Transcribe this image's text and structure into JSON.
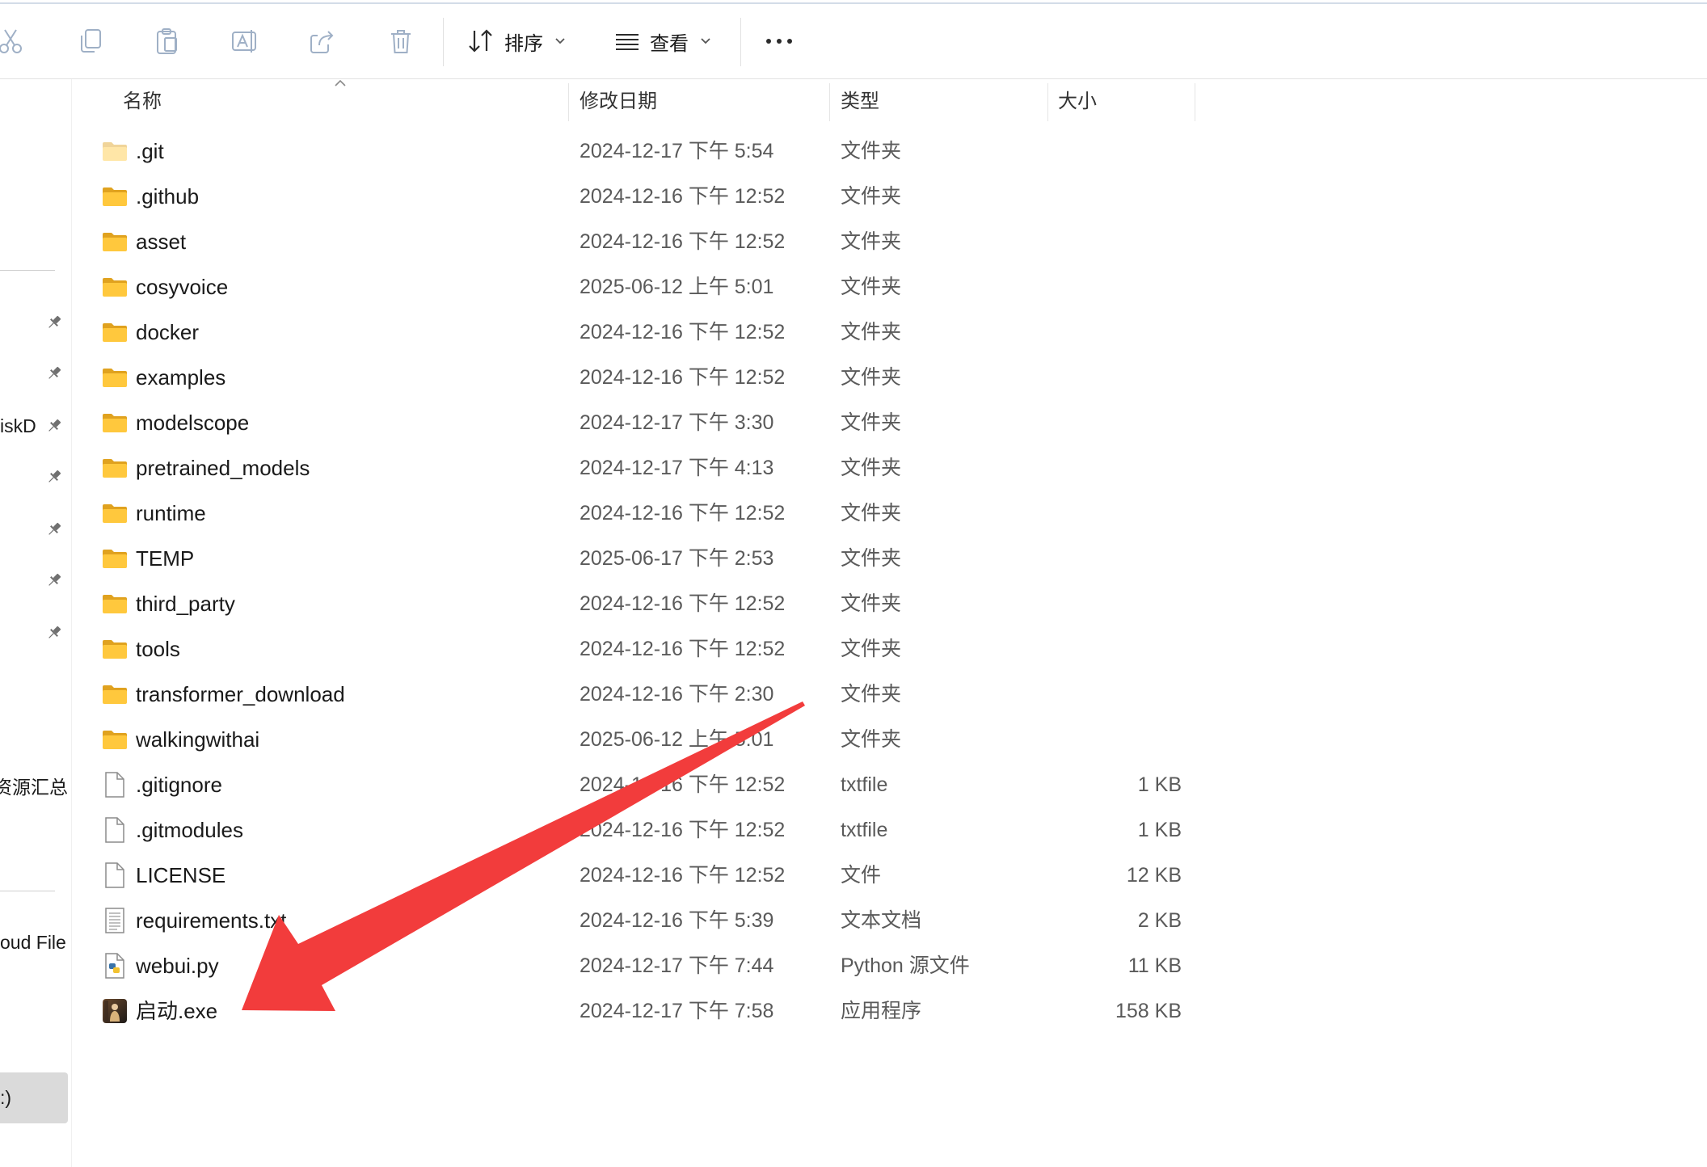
{
  "toolbar": {
    "icons": [
      "cut-icon",
      "copy-icon",
      "paste-icon",
      "rename-icon",
      "share-icon",
      "delete-icon"
    ],
    "sort_label": "排序",
    "view_label": "查看",
    "icon_color": "#9fb0c6"
  },
  "sidebar": {
    "items": [
      {
        "label": "iskD",
        "pinned": true
      },
      {
        "label": "资源汇总"
      },
      {
        "label": "oud File"
      },
      {
        "label": ":)",
        "selected": true
      }
    ]
  },
  "file_list": {
    "columns": {
      "name": "名称",
      "modified": "修改日期",
      "type": "类型",
      "size": "大小"
    },
    "sort": {
      "column": "name",
      "direction": "ascending"
    },
    "rows": [
      {
        "name": ".git",
        "modified": "2024-12-17 下午 5:54",
        "type": "文件夹",
        "icon": "folder-hidden-icon"
      },
      {
        "name": ".github",
        "modified": "2024-12-16 下午 12:52",
        "type": "文件夹",
        "icon": "folder-icon"
      },
      {
        "name": "asset",
        "modified": "2024-12-16 下午 12:52",
        "type": "文件夹",
        "icon": "folder-icon"
      },
      {
        "name": "cosyvoice",
        "modified": "2025-06-12 上午 5:01",
        "type": "文件夹",
        "icon": "folder-icon"
      },
      {
        "name": "docker",
        "modified": "2024-12-16 下午 12:52",
        "type": "文件夹",
        "icon": "folder-icon"
      },
      {
        "name": "examples",
        "modified": "2024-12-16 下午 12:52",
        "type": "文件夹",
        "icon": "folder-icon"
      },
      {
        "name": "modelscope",
        "modified": "2024-12-17 下午 3:30",
        "type": "文件夹",
        "icon": "folder-icon"
      },
      {
        "name": "pretrained_models",
        "modified": "2024-12-17 下午 4:13",
        "type": "文件夹",
        "icon": "folder-icon"
      },
      {
        "name": "runtime",
        "modified": "2024-12-16 下午 12:52",
        "type": "文件夹",
        "icon": "folder-icon"
      },
      {
        "name": "TEMP",
        "modified": "2025-06-17 下午 2:53",
        "type": "文件夹",
        "icon": "folder-icon"
      },
      {
        "name": "third_party",
        "modified": "2024-12-16 下午 12:52",
        "type": "文件夹",
        "icon": "folder-icon"
      },
      {
        "name": "tools",
        "modified": "2024-12-16 下午 12:52",
        "type": "文件夹",
        "icon": "folder-icon"
      },
      {
        "name": "transformer_download",
        "modified": "2024-12-16 下午 2:30",
        "type": "文件夹",
        "icon": "folder-icon"
      },
      {
        "name": "walkingwithai",
        "modified": "2025-06-12 上午 5:01",
        "type": "文件夹",
        "icon": "folder-icon"
      },
      {
        "name": ".gitignore",
        "modified": "2024-12-16 下午 12:52",
        "type": "txtfile",
        "size": "1 KB",
        "icon": "file-icon"
      },
      {
        "name": ".gitmodules",
        "modified": "2024-12-16 下午 12:52",
        "type": "txtfile",
        "size": "1 KB",
        "icon": "file-icon"
      },
      {
        "name": "LICENSE",
        "modified": "2024-12-16 下午 12:52",
        "type": "文件",
        "size": "12 KB",
        "icon": "file-icon"
      },
      {
        "name": "requirements.txt",
        "modified": "2024-12-16 下午 5:39",
        "type": "文本文档",
        "size": "2 KB",
        "icon": "text-document-icon"
      },
      {
        "name": "webui.py",
        "modified": "2024-12-17 下午 7:44",
        "type": "Python 源文件",
        "size": "11 KB",
        "icon": "python-file-icon"
      },
      {
        "name": "启动.exe",
        "modified": "2024-12-17 下午 7:58",
        "type": "应用程序",
        "size": "158 KB",
        "icon": "exe-app-icon"
      }
    ]
  },
  "annotation": {
    "kind": "arrow",
    "color": "#f23c3c",
    "points_to": "启动.exe"
  }
}
